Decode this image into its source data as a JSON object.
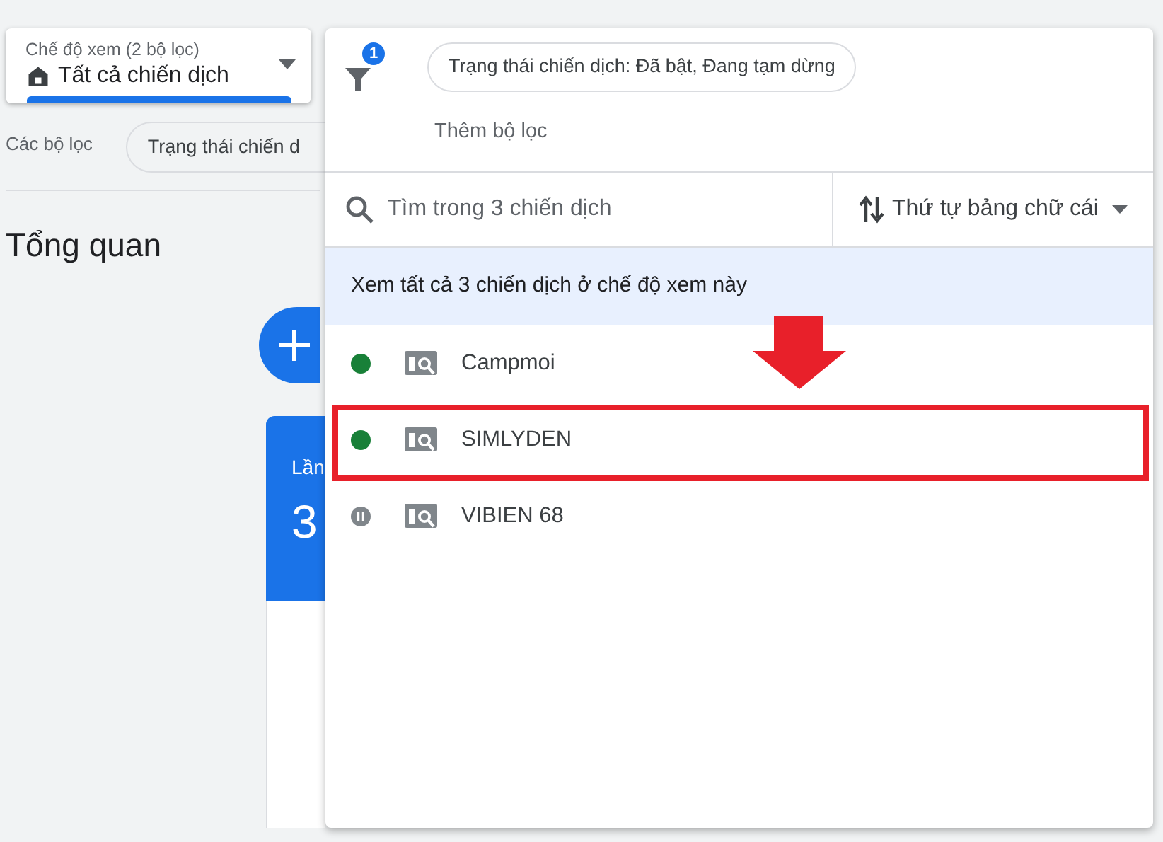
{
  "view_selector": {
    "label": "Chế độ xem (2 bộ lọc)",
    "value": "Tất cả chiến dịch"
  },
  "filters": {
    "label": "Các bộ lọc",
    "chips": [
      "Trạng thái chiến d"
    ]
  },
  "page_title": "Tổng quan",
  "summary_card": {
    "label": "Lần",
    "value": "3"
  },
  "popup": {
    "filter_count": "1",
    "filter_chips": [
      "Trạng thái chiến dịch: Đã bật, Đang tạm dừng"
    ],
    "add_filter": "Thêm bộ lọc",
    "search": {
      "placeholder": "Tìm trong 3 chiến dịch"
    },
    "sort": "Thứ tự bảng chữ cái",
    "view_all": "Xem tất cả 3 chiến dịch ở chế độ xem này",
    "campaigns": [
      {
        "name": "Campmoi",
        "kind": "enabled",
        "highlighted": false
      },
      {
        "name": "SIMLYDEN",
        "kind": "enabled",
        "highlighted": true
      },
      {
        "name": "VIBIEN 68",
        "kind": "paused",
        "highlighted": false
      }
    ]
  }
}
